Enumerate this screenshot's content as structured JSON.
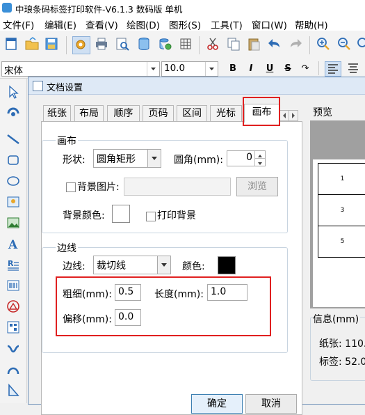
{
  "app": {
    "title": "中琅条码标签打印软件-V6.1.3 数码版 单机"
  },
  "menu": [
    "文件(F)",
    "编辑(E)",
    "查看(V)",
    "绘图(D)",
    "图形(S)",
    "工具(T)",
    "窗口(W)",
    "帮助(H)"
  ],
  "format_bar": {
    "font_name": "宋体",
    "font_size": "10.0",
    "bold": "B",
    "italic": "I",
    "underline": "U",
    "strike": "S"
  },
  "dialog": {
    "title": "文档设置",
    "tabs": [
      "纸张",
      "布局",
      "顺序",
      "页码",
      "区间",
      "光标",
      "画布"
    ],
    "active_tab": "画布",
    "canvas_group": {
      "title": "画布",
      "shape_label": "形状:",
      "shape_value": "圆角矩形",
      "radius_label": "圆角(mm):",
      "radius_value": "0",
      "bg_image_label": "背景图片:",
      "bg_image_value": "",
      "browse_button": "浏览",
      "bg_color_label": "背景颜色:",
      "bg_color": "#ffffff",
      "print_bg_label": "打印背景"
    },
    "border_group": {
      "title": "边线",
      "border_label": "边线:",
      "border_value": "裁切线",
      "color_label": "颜色:",
      "color": "#000000",
      "thickness_label": "粗细(mm):",
      "thickness_value": "0.5",
      "length_label": "长度(mm):",
      "length_value": "1.0",
      "offset_label": "偏移(mm):",
      "offset_value": "0.0"
    },
    "ok_button": "确定",
    "cancel_button": "取消",
    "preview": {
      "title": "预览",
      "labels": [
        "1",
        "3",
        "5"
      ]
    },
    "info": {
      "title": "信息(mm)",
      "paper_label": "纸张: 110.",
      "label_label": "标签: 52.0"
    }
  },
  "highlight_color": "#e02020"
}
